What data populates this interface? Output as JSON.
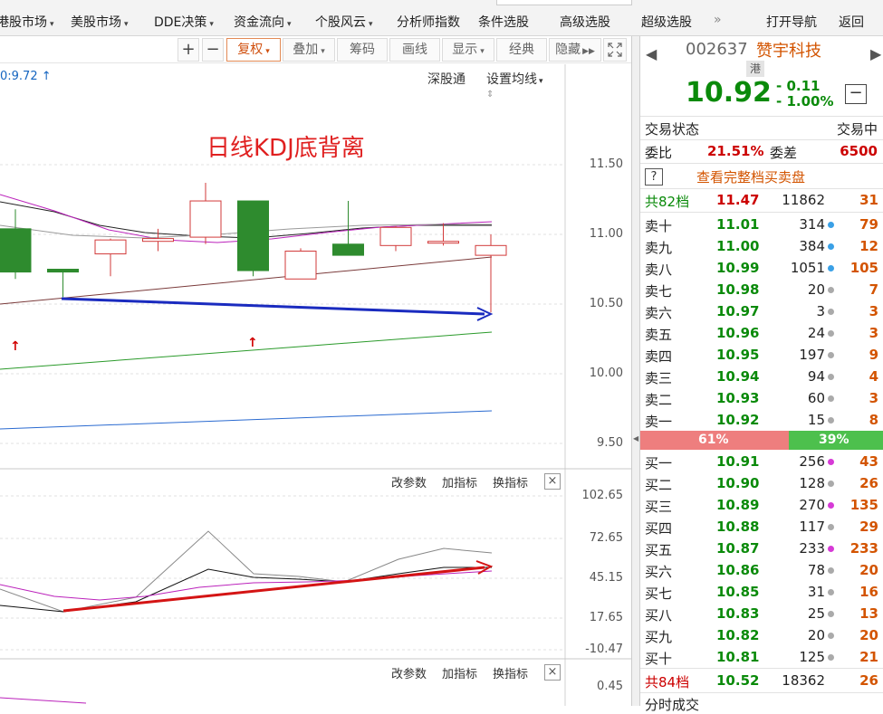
{
  "menubar": {
    "items": [
      {
        "label": "港股市场",
        "arrow": "▾"
      },
      {
        "label": "美股市场",
        "arrow": "▾"
      },
      {
        "label": "DDE决策",
        "arrow": "▾"
      },
      {
        "label": "资金流向",
        "arrow": "▾"
      },
      {
        "label": "个股风云",
        "arrow": "▾"
      },
      {
        "label": "分析师指数",
        "arrow": ""
      },
      {
        "label": "条件选股",
        "arrow": ""
      },
      {
        "label": "高级选股",
        "arrow": ""
      },
      {
        "label": "超级选股",
        "arrow": ""
      }
    ],
    "more": "»",
    "open_nav": "打开导航",
    "back": "返回"
  },
  "toolbar": {
    "plus": "+",
    "minus": "−",
    "fuquan": "复权",
    "diejia": "叠加",
    "chouma": "筹码",
    "huaxian": "画线",
    "xianshi": "显示",
    "jingdian": "经典",
    "yincang": "隐藏"
  },
  "chart": {
    "ma_value_text": "0:9.72 ↑",
    "shengutong": "深股通",
    "set_ma": "设置均线",
    "annotation": "日线KDJ底背离",
    "price_axis": [
      "11.50",
      "11.00",
      "10.50",
      "10.00",
      "9.50"
    ],
    "kdj_axis": [
      "102.65",
      "72.65",
      "45.15",
      "17.65",
      "-10.47"
    ],
    "lower_axis": [
      "0.45"
    ],
    "panel_links": {
      "change_params": "改参数",
      "add_indicator": "加指标",
      "switch_indicator": "换指标"
    },
    "close_glyph": "×"
  },
  "chart_data": {
    "type": "candlestick",
    "candles": [
      {
        "open": 11.04,
        "close": 10.73,
        "high": 11.18,
        "low": 10.68
      },
      {
        "open": 10.75,
        "close": 10.73,
        "high": 10.75,
        "low": 10.55
      },
      {
        "open": 10.86,
        "close": 10.96,
        "high": 10.97,
        "low": 10.7
      },
      {
        "open": 10.95,
        "close": 10.97,
        "high": 11.04,
        "low": 10.88
      },
      {
        "open": 10.98,
        "close": 11.24,
        "high": 11.37,
        "low": 10.93
      },
      {
        "open": 11.24,
        "close": 10.74,
        "high": 11.24,
        "low": 10.7
      },
      {
        "open": 10.68,
        "close": 10.88,
        "high": 10.9,
        "low": 10.68
      },
      {
        "open": 10.93,
        "close": 10.85,
        "high": 11.24,
        "low": 10.85
      },
      {
        "open": 10.92,
        "close": 11.05,
        "high": 11.06,
        "low": 10.88
      },
      {
        "open": 10.95,
        "close": 10.95,
        "high": 11.08,
        "low": 10.92
      },
      {
        "open": 10.85,
        "close": 10.92,
        "high": 11.0,
        "low": 10.44
      }
    ],
    "price_range": [
      9.5,
      11.5
    ],
    "kdj_range": [
      -10.47,
      102.65
    ]
  },
  "quote": {
    "code": "002637",
    "name": "赞宇科技",
    "hk_tag": "港",
    "price": "10.92",
    "change": "- 0.11",
    "change_pct": "- 1.00%",
    "minus_btn": "−",
    "status_label": "交易状态",
    "status_value": "交易中",
    "weibi_label": "委比",
    "weibi_value": "21.51%",
    "weicha_label": "委差",
    "weicha_value": "6500",
    "help": "?",
    "full_book": "查看完整档买卖盘",
    "total_ask": {
      "label": "共82档",
      "price": "11.47",
      "vol": "11862",
      "cnt": "31"
    },
    "asks": [
      {
        "label": "卖十",
        "price": "11.01",
        "vol": "314",
        "dot": "#3aa0e6",
        "cnt": "79"
      },
      {
        "label": "卖九",
        "price": "11.00",
        "vol": "384",
        "dot": "#3aa0e6",
        "cnt": "12"
      },
      {
        "label": "卖八",
        "price": "10.99",
        "vol": "1051",
        "dot": "#3aa0e6",
        "cnt": "105"
      },
      {
        "label": "卖七",
        "price": "10.98",
        "vol": "20",
        "dot": "#aaaaaa",
        "cnt": "7"
      },
      {
        "label": "卖六",
        "price": "10.97",
        "vol": "3",
        "dot": "#aaaaaa",
        "cnt": "3"
      },
      {
        "label": "卖五",
        "price": "10.96",
        "vol": "24",
        "dot": "#aaaaaa",
        "cnt": "3"
      },
      {
        "label": "卖四",
        "price": "10.95",
        "vol": "197",
        "dot": "#aaaaaa",
        "cnt": "9"
      },
      {
        "label": "卖三",
        "price": "10.94",
        "vol": "94",
        "dot": "#aaaaaa",
        "cnt": "4"
      },
      {
        "label": "卖二",
        "price": "10.93",
        "vol": "60",
        "dot": "#aaaaaa",
        "cnt": "3"
      },
      {
        "label": "卖一",
        "price": "10.92",
        "vol": "15",
        "dot": "#aaaaaa",
        "cnt": "8"
      }
    ],
    "ratio_sell": "61%",
    "ratio_buy": "39%",
    "ratio_sell_fraction": 0.61,
    "bids": [
      {
        "label": "买一",
        "price": "10.91",
        "vol": "256",
        "dot": "#d63ad6",
        "cnt": "43"
      },
      {
        "label": "买二",
        "price": "10.90",
        "vol": "128",
        "dot": "#aaaaaa",
        "cnt": "26"
      },
      {
        "label": "买三",
        "price": "10.89",
        "vol": "270",
        "dot": "#d63ad6",
        "cnt": "135"
      },
      {
        "label": "买四",
        "price": "10.88",
        "vol": "117",
        "dot": "#aaaaaa",
        "cnt": "29"
      },
      {
        "label": "买五",
        "price": "10.87",
        "vol": "233",
        "dot": "#d63ad6",
        "cnt": "233"
      },
      {
        "label": "买六",
        "price": "10.86",
        "vol": "78",
        "dot": "#aaaaaa",
        "cnt": "20"
      },
      {
        "label": "买七",
        "price": "10.85",
        "vol": "31",
        "dot": "#aaaaaa",
        "cnt": "16"
      },
      {
        "label": "买八",
        "price": "10.83",
        "vol": "25",
        "dot": "#aaaaaa",
        "cnt": "13"
      },
      {
        "label": "买九",
        "price": "10.82",
        "vol": "20",
        "dot": "#aaaaaa",
        "cnt": "20"
      },
      {
        "label": "买十",
        "price": "10.81",
        "vol": "125",
        "dot": "#aaaaaa",
        "cnt": "21"
      }
    ],
    "total_bid": {
      "label": "共84档",
      "price": "10.52",
      "vol": "18362",
      "cnt": "26"
    },
    "bottom_tab": "分时成交"
  }
}
